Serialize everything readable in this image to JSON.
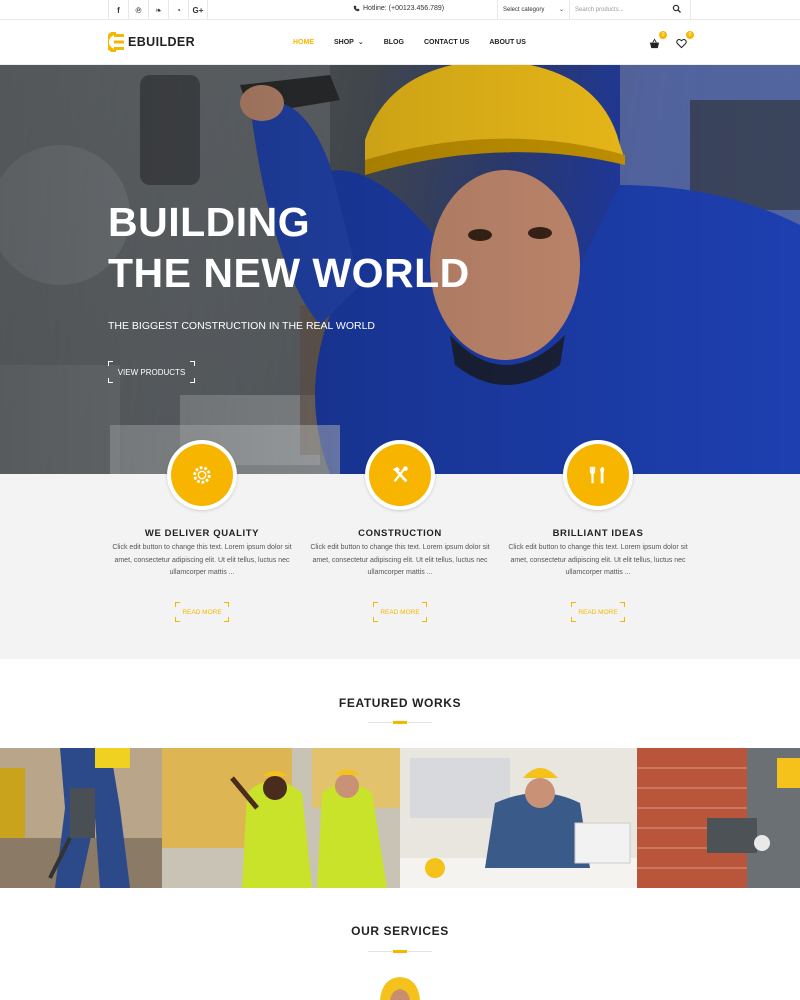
{
  "topbar": {
    "social": [
      {
        "icon": "facebook-icon",
        "glyph": "f"
      },
      {
        "icon": "pinterest-icon",
        "glyph": "℗"
      },
      {
        "icon": "twitter-icon",
        "glyph": "❧"
      },
      {
        "icon": "rss-icon",
        "glyph": "◔"
      },
      {
        "icon": "google-plus-icon",
        "glyph": "G+"
      }
    ],
    "hotline": "Hotline: (+00123.456.789)",
    "category_select": "Select category",
    "search_placeholder": "Search products..."
  },
  "header": {
    "logo_text": "EBUILDER",
    "nav": [
      {
        "label": "HOME",
        "active": true
      },
      {
        "label": "SHOP",
        "has_dropdown": true
      },
      {
        "label": "BLOG"
      },
      {
        "label": "CONTACT US"
      },
      {
        "label": "ABOUT US"
      }
    ],
    "cart_count": "0",
    "wishlist_count": "0"
  },
  "hero": {
    "title_line1": "BUILDING",
    "title_line2": "THE NEW WORLD",
    "subtitle": "THE BIGGEST CONSTRUCTION IN THE REAL WORLD",
    "button_label": "VIEW PRODUCTS"
  },
  "features": [
    {
      "icon": "gear-icon",
      "title": "WE DELIVER QUALITY",
      "text": "Click edit button to change this text. Lorem ipsum dolor sit amet, consectetur adipiscing elit. Ut elit tellus, luctus nec ullamcorper mattis ...",
      "link": "READ MORE"
    },
    {
      "icon": "hammer-icon",
      "title": "CONSTRUCTION",
      "text": "Click edit button to change this text. Lorem ipsum dolor sit amet, consectetur adipiscing elit. Ut elit tellus, luctus nec ullamcorper mattis ...",
      "link": "READ MORE"
    },
    {
      "icon": "tools-icon",
      "title": "BRILLIANT IDEAS",
      "text": "Click edit button to change this text. Lorem ipsum dolor sit amet, consectetur adipiscing elit. Ut elit tellus, luctus nec ullamcorper mattis ...",
      "link": "READ MORE"
    }
  ],
  "featured_works": {
    "title": "FEATURED WORKS"
  },
  "services": {
    "title": "OUR SERVICES"
  },
  "colors": {
    "accent": "#f5b800",
    "hero_blue": "#1f3aa5",
    "light_bg": "#f3f3f3"
  }
}
